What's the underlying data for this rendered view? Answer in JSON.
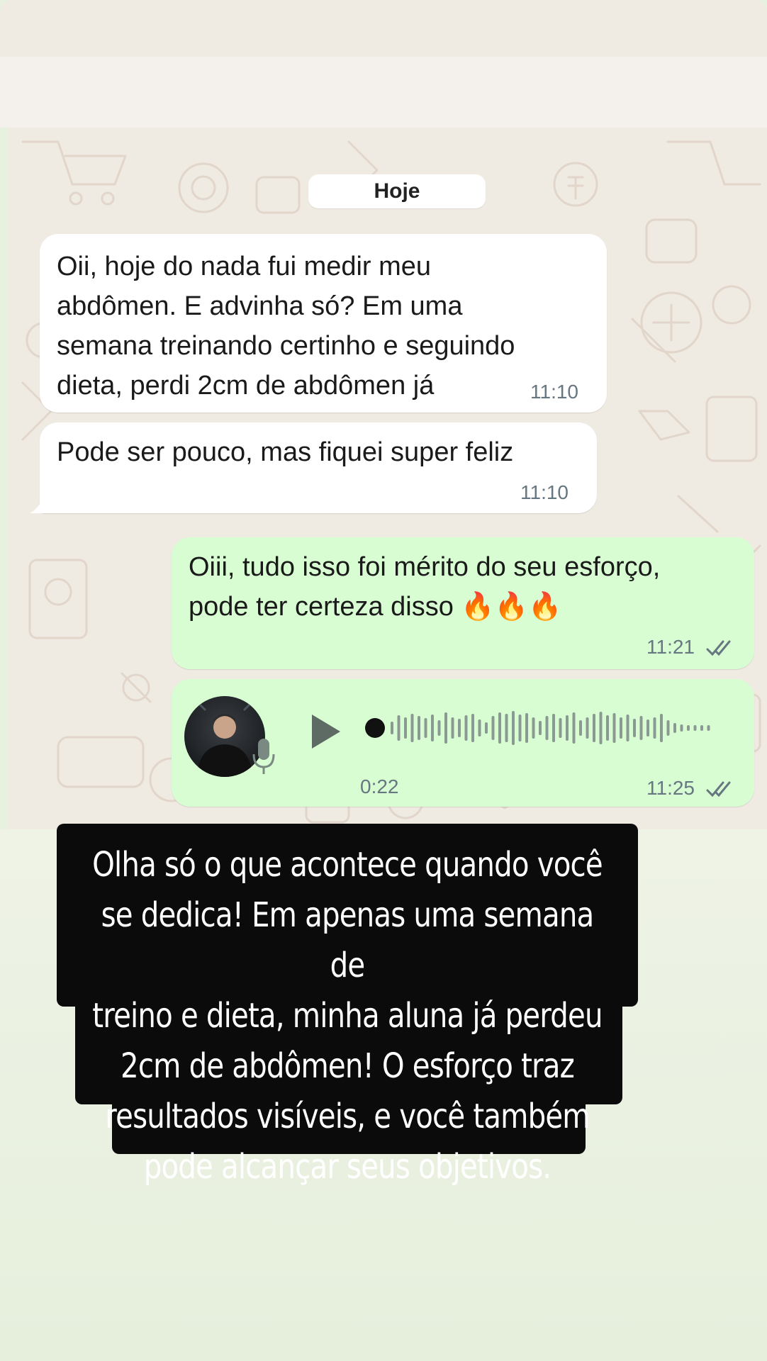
{
  "chat": {
    "date_chip": "Hoje",
    "messages": [
      {
        "direction": "incoming",
        "lines": [
          "Oii, hoje do nada fui medir meu",
          "abdômen. E advinha só? Em uma",
          "semana treinando certinho e seguindo",
          "dieta, perdi 2cm de abdômen já"
        ],
        "time": "11:10"
      },
      {
        "direction": "incoming",
        "lines": [
          "Pode ser pouco, mas fiquei super feliz"
        ],
        "time": "11:10"
      },
      {
        "direction": "outgoing",
        "lines": [
          "Oiii, tudo isso foi mérito do seu esforço,",
          "pode ter certeza disso 🔥🔥🔥"
        ],
        "time": "11:21",
        "status": "double-check-icon"
      },
      {
        "direction": "outgoing",
        "type": "voice",
        "duration": "0:22",
        "time": "11:25",
        "status": "double-check-icon",
        "progress": 0
      }
    ]
  },
  "caption": {
    "lines": [
      "Olha só o que acontece quando você",
      "se dedica! Em apenas uma semana de",
      "treino e dieta, minha aluna já perdeu",
      "2cm de abdômen! O esforço traz",
      "resultados visíveis, e você também",
      "pode alcançar seus objetivos."
    ]
  },
  "colors": {
    "incoming_bubble": "#ffffff",
    "outgoing_bubble": "#d9fdd3",
    "wallpaper": "#efeae2",
    "caption_bg": "#0b0b0b",
    "timestamp": "#667781",
    "waveform": "#7a8a82"
  }
}
